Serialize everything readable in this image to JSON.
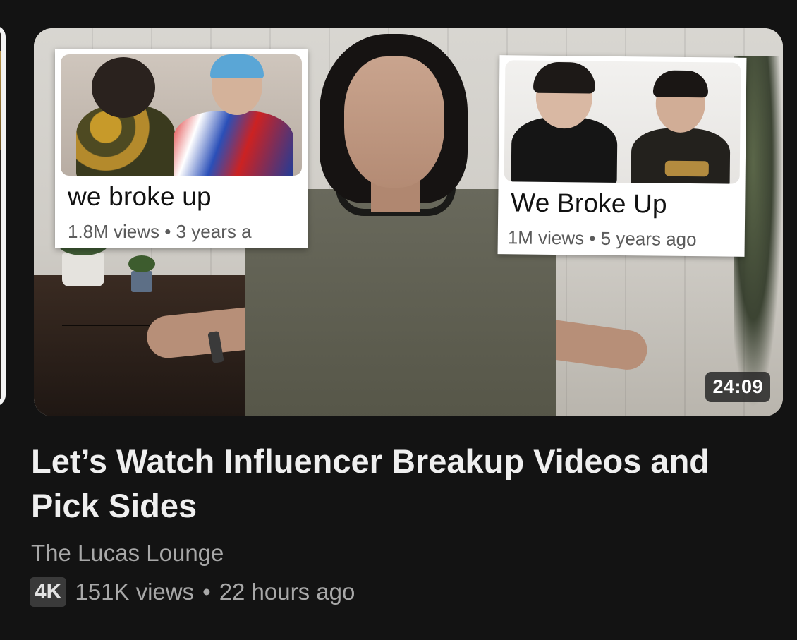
{
  "video": {
    "duration": "24:09",
    "title": "Let’s Watch Influencer Breakup Videos and Pick Sides",
    "channel": "The Lucas Lounge",
    "quality_badge": "4K",
    "views": "151K views",
    "separator": "•",
    "age": "22 hours ago"
  },
  "thumbnail_insets": [
    {
      "title": "we broke up",
      "meta": "1.8M views • 3 years a"
    },
    {
      "title": "We Broke Up",
      "meta": "1M views • 5 years ago"
    }
  ],
  "colors": {
    "background": "#131313",
    "title_text": "#efefef",
    "secondary_text": "#a8a8a8",
    "badge_bg": "#3a3a3a"
  }
}
